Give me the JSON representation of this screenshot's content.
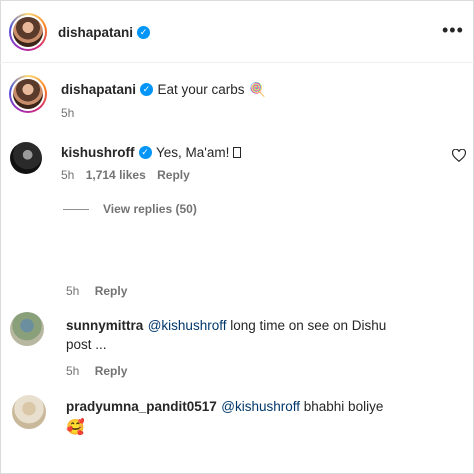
{
  "header": {
    "username": "dishapatani",
    "more_icon": "more-horizontal-icon"
  },
  "caption": {
    "username": "dishapatani",
    "text": "Eat your carbs",
    "emoji": "🍭",
    "time": "5h"
  },
  "comments": [
    {
      "username": "kishushroff",
      "verified": true,
      "text": "Yes, Ma'am! ",
      "time": "5h",
      "likes": "1,714 likes",
      "reply_label": "Reply",
      "view_replies": "View replies (50)"
    },
    {
      "time": "5h",
      "reply_label": "Reply"
    },
    {
      "username": "sunnymittra",
      "mention": "@kishushroff",
      "text": " long time on see on Dishu",
      "text2": "post ...",
      "time": "5h",
      "reply_label": "Reply"
    },
    {
      "username": "pradyumna_pandit0517",
      "mention": "@kishushroff",
      "text": " bhabhi boliye",
      "emoji": "🥰"
    }
  ],
  "icons": {
    "verified": "verified-badge-icon",
    "like": "heart-outline-icon"
  },
  "colors": {
    "verified_blue": "#0095f6",
    "mention_blue": "#00376b",
    "meta_gray": "#737373"
  }
}
